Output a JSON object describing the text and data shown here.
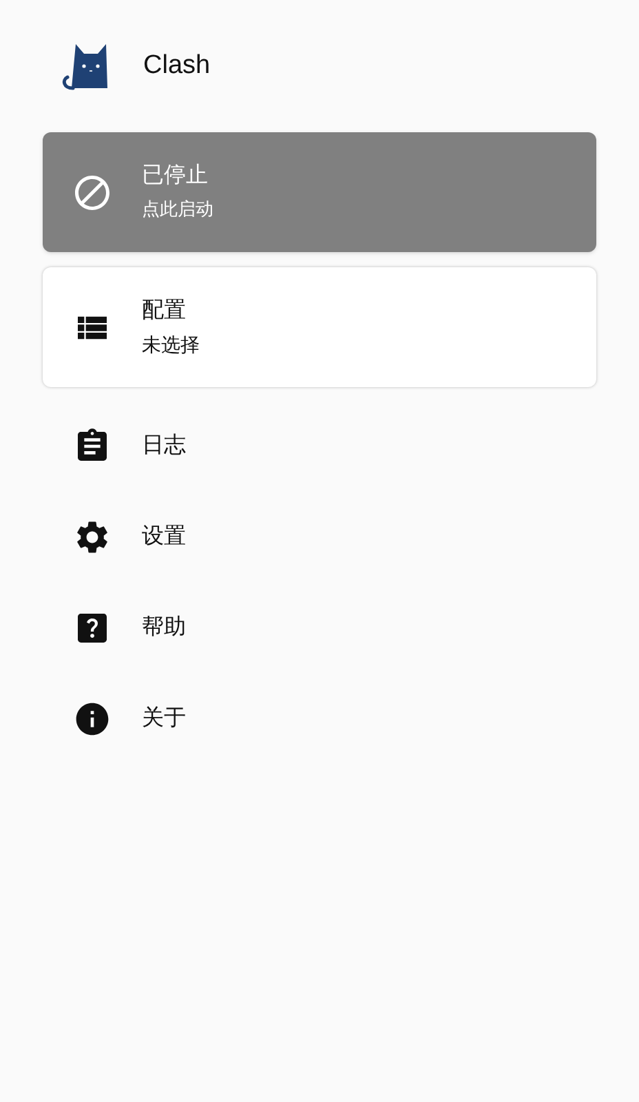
{
  "header": {
    "title": "Clash"
  },
  "status_card": {
    "title": "已停止",
    "subtitle": "点此启动",
    "running": false
  },
  "profile_card": {
    "title": "配置",
    "subtitle": "未选择"
  },
  "menu": [
    {
      "kind": "logs",
      "label": "日志"
    },
    {
      "kind": "settings",
      "label": "设置"
    },
    {
      "kind": "help",
      "label": "帮助"
    },
    {
      "kind": "about",
      "label": "关于"
    }
  ]
}
